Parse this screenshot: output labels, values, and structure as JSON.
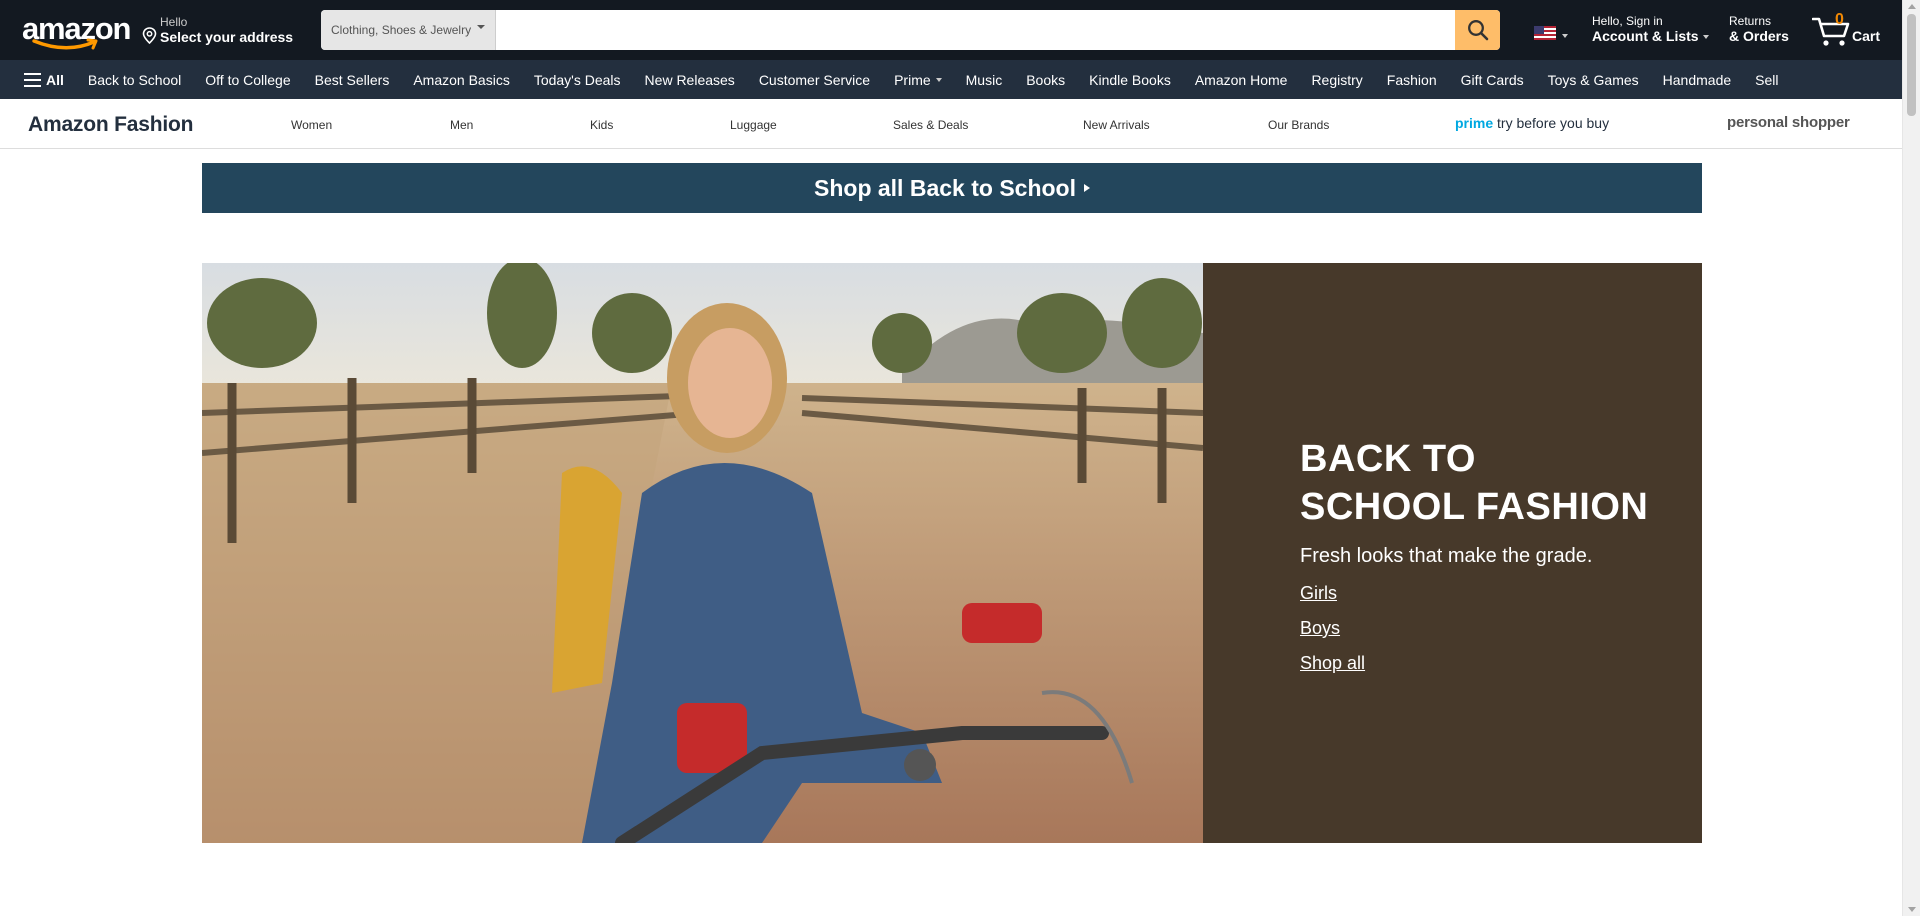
{
  "header": {
    "logo_text": "amazon",
    "address": {
      "line1": "Hello",
      "line2": "Select your address"
    },
    "search": {
      "category": "Clothing, Shoes & Jewelry",
      "placeholder": "",
      "value": ""
    },
    "account": {
      "line1": "Hello, Sign in",
      "line2": "Account & Lists"
    },
    "returns": {
      "line1": "Returns",
      "line2": "& Orders"
    },
    "cart": {
      "count": "0",
      "label": "Cart"
    }
  },
  "nav": {
    "all_label": "All",
    "items": [
      {
        "label": "Back to School"
      },
      {
        "label": "Off to College"
      },
      {
        "label": "Best Sellers"
      },
      {
        "label": "Amazon Basics"
      },
      {
        "label": "Today's Deals"
      },
      {
        "label": "New Releases"
      },
      {
        "label": "Customer Service"
      },
      {
        "label": "Prime"
      },
      {
        "label": "Music"
      },
      {
        "label": "Books"
      },
      {
        "label": "Kindle Books"
      },
      {
        "label": "Amazon Home"
      },
      {
        "label": "Registry"
      },
      {
        "label": "Fashion"
      },
      {
        "label": "Gift Cards"
      },
      {
        "label": "Toys & Games"
      },
      {
        "label": "Handmade"
      },
      {
        "label": "Sell"
      }
    ]
  },
  "fashion_nav": {
    "brand": "Amazon Fashion",
    "links": [
      "Women",
      "Men",
      "Kids",
      "Luggage",
      "Sales & Deals",
      "New Arrivals",
      "Our Brands"
    ],
    "prime_word": "prime",
    "prime_rest": " try before you buy",
    "personal_shopper": "personal shopper"
  },
  "banner": {
    "label": "Shop all Back to School"
  },
  "hero": {
    "title_line1": "BACK TO",
    "title_line2": "SCHOOL FASHION",
    "subtitle": "Fresh looks that make the grade.",
    "links": [
      "Girls",
      "Boys",
      "Shop all"
    ]
  },
  "colors": {
    "nav_top": "#131921",
    "nav_main": "#232f3e",
    "search_button": "#febd69",
    "banner": "#23465c",
    "hero_panel": "#47392a",
    "cart_count": "#f08804",
    "prime_blue": "#00a8e1"
  }
}
